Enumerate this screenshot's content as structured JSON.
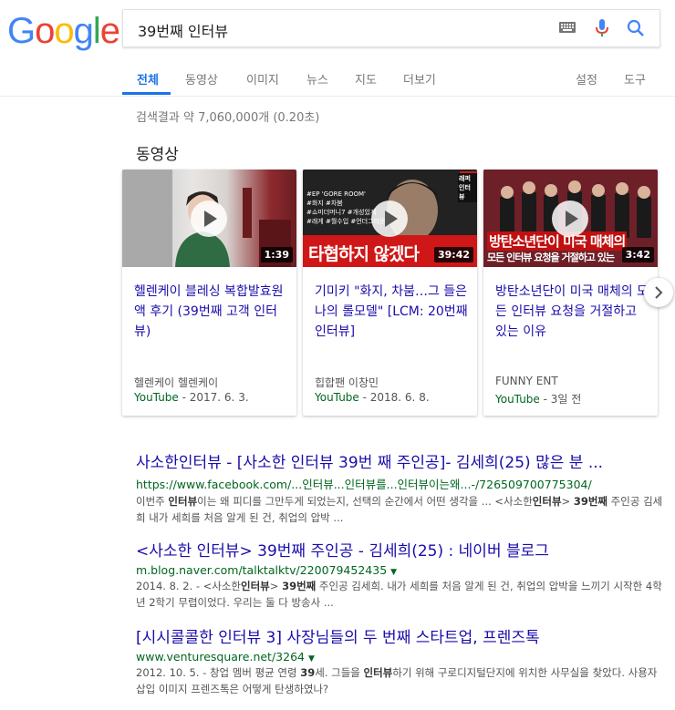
{
  "logo": {
    "letters": [
      "G",
      "o",
      "o",
      "g",
      "l",
      "e"
    ]
  },
  "search": {
    "query": "39번째 인터뷰"
  },
  "tabs": [
    {
      "label": "전체"
    },
    {
      "label": "동영상"
    },
    {
      "label": "이미지"
    },
    {
      "label": "뉴스"
    },
    {
      "label": "지도"
    },
    {
      "label": "더보기"
    }
  ],
  "tools": {
    "settings": "설정",
    "tools": "도구"
  },
  "stats": "검색결과 약 7,060,000개 (0.20초)",
  "video_section": {
    "title": "동영상",
    "cards": [
      {
        "title": "헬렌케이 블레싱 복합발효원액 후기 (39번째 고객 인터뷰)",
        "author": "헬렌케이 헬렌케이",
        "source": "YouTube",
        "date": " - 2017. 6. 3.",
        "duration": "1:39"
      },
      {
        "title": "기미키 \"화지, 차붐…그 들은 나의 롤모델\" [LCM: 20번째 인터뷰]",
        "author": "힙합팬 이창민",
        "source": "YouTube",
        "date": " - 2018. 6. 8.",
        "duration": "39:42",
        "overlay": "타협하지 않겠다",
        "tags": "#EP 'GORE ROOM'\n#화지 #차붐\n#쇼미더머니7 #개성있게\n#래게 #월수입 #언더그라운드",
        "badge": "래퍼 인터뷰"
      },
      {
        "title": "방탄소년단이 미국 매체의 모든 인터뷰 요청을 거절하고 있는 이유",
        "author": "FUNNY ENT",
        "source": "YouTube",
        "date": " - 3일 전",
        "duration": "3:42",
        "overlay": "방탄소년단이 미국 매체의",
        "overlay2": "모든 인터뷰 요청을 거절하고 있는"
      }
    ]
  },
  "results": [
    {
      "title": "사소한인터뷰 - [사소한 인터뷰 39번 째 주인공]- 김세희(25) 많은 분 ...",
      "url": "https://www.facebook.com/...인터뷰...인터뷰를...인터뷰이는왜...-/726509700775304/",
      "snippet": [
        "이번주 ",
        "인터뷰",
        "이는 왜 피디를 그만두게 되었는지, 선택의 순간에서 어떤 생각을 ... <사소한",
        "인터뷰",
        "> ",
        "39번째",
        " 주인공 김세희 내가 세희를 처음 알게 된 건, 취업의 압박 ..."
      ]
    },
    {
      "title": "<사소한 인터뷰> 39번째 주인공 - 김세희(25) : 네이버 블로그",
      "url": "m.blog.naver.com/talktalktv/220079452435",
      "snippet": [
        "2014. 8. 2. - <사소한",
        "인터뷰",
        "> ",
        "39번째",
        " 주인공 김세희. 내가 세희를 처음 알게 된 건, 취업의 압박을 느끼기 시작한 4학년 2학기 무렵이었다. 우리는 둘 다 방송사 ..."
      ]
    },
    {
      "title": "[시시콜콜한 인터뷰 3] 사장님들의 두 번째 스타트업, 프렌즈톡",
      "url": "www.venturesquare.net/3264",
      "snippet": [
        "2012. 10. 5. - 창업 멤버 평균 연령 ",
        "39",
        "세. 그들을 ",
        "인터뷰",
        "하기 위해 구로디지털단지에 위치한 사무실을 찾았다. 사용자 삽입 이미지 프렌즈톡은 어떻게 탄생하였나?"
      ]
    }
  ]
}
